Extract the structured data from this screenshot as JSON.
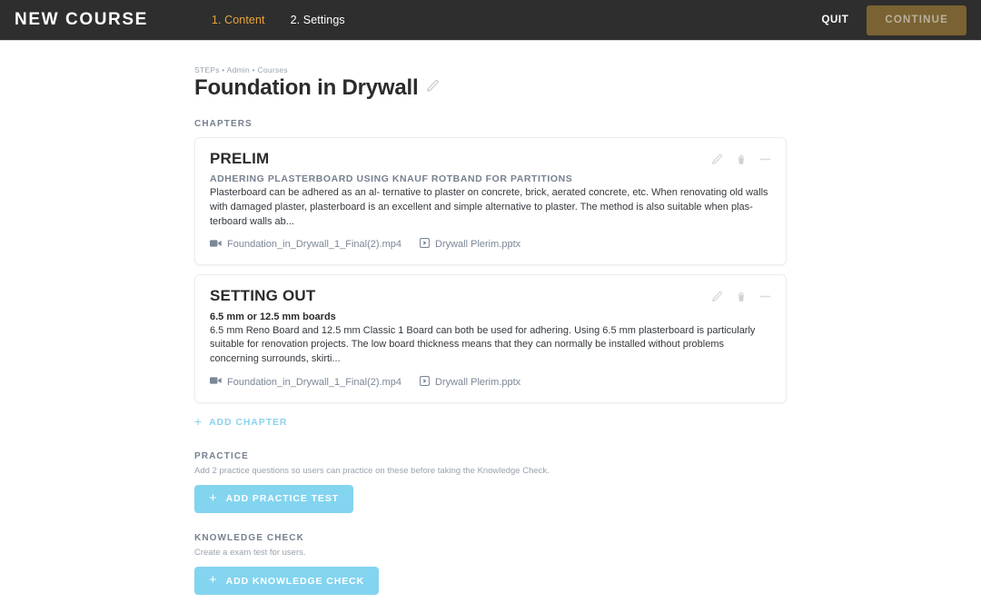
{
  "header": {
    "logo": "NEW COURSE",
    "tabs": [
      {
        "label": "1. Content",
        "active": true
      },
      {
        "label": "2. Settings",
        "active": false
      }
    ],
    "quit_label": "QUIT",
    "continue_label": "CONTINUE",
    "colors": {
      "background": "#2e2e2e",
      "active_tab": "#e8a33d",
      "continue_bg": "#7a6232",
      "continue_text": "#b9b0a0"
    }
  },
  "breadcrumb": "STEPs • Admin • Courses",
  "page_title": "Foundation in Drywall",
  "chapters_label": "CHAPTERS",
  "chapters": [
    {
      "title": "PRELIM",
      "subtitle": "ADHERING PLASTERBOARD USING KNAUF ROTBAND FOR PARTITIONS",
      "subtitle_style": "uppercase",
      "body": "Plasterboard can be adhered as an al- ternative to plaster on concrete, brick, aerated concrete, etc. When renovating old walls with damaged plaster, plasterboard is an excellent and simple alternative to plaster. The method is also suitable when plas- terboard walls ab...",
      "attachments": [
        {
          "icon": "video-icon",
          "name": "Foundation_in_Drywall_1_Final(2).mp4"
        },
        {
          "icon": "presentation-icon",
          "name": "Drywall Plerim.pptx"
        }
      ]
    },
    {
      "title": "SETTING OUT",
      "subtitle": "6.5 mm or 12.5 mm boards",
      "subtitle_style": "plain",
      "body": "6.5 mm Reno Board and 12.5 mm Classic 1 Board can both be used for adhering. Using 6.5 mm plasterboard is particularly suitable for renovation projects. The low board thickness means that they can normally be installed without problems concerning surrounds, skirti...",
      "attachments": [
        {
          "icon": "video-icon",
          "name": "Foundation_in_Drywall_1_Final(2).mp4"
        },
        {
          "icon": "presentation-icon",
          "name": "Drywall Plerim.pptx"
        }
      ]
    }
  ],
  "add_chapter_label": "ADD CHAPTER",
  "practice": {
    "label": "PRACTICE",
    "description": "Add 2 practice questions so users can practice on these before taking the Knowledge Check.",
    "button_label": "ADD PRACTICE TEST"
  },
  "knowledge_check": {
    "label": "KNOWLEDGE CHECK",
    "description": "Create a exam test for users.",
    "button_label": "ADD KNOWLEDGE CHECK"
  },
  "icons": {
    "plus": "+",
    "edit": "pencil-icon",
    "delete": "trash-icon",
    "drag": "drag-handle-icon"
  },
  "accent_blue": "#83d4ef"
}
